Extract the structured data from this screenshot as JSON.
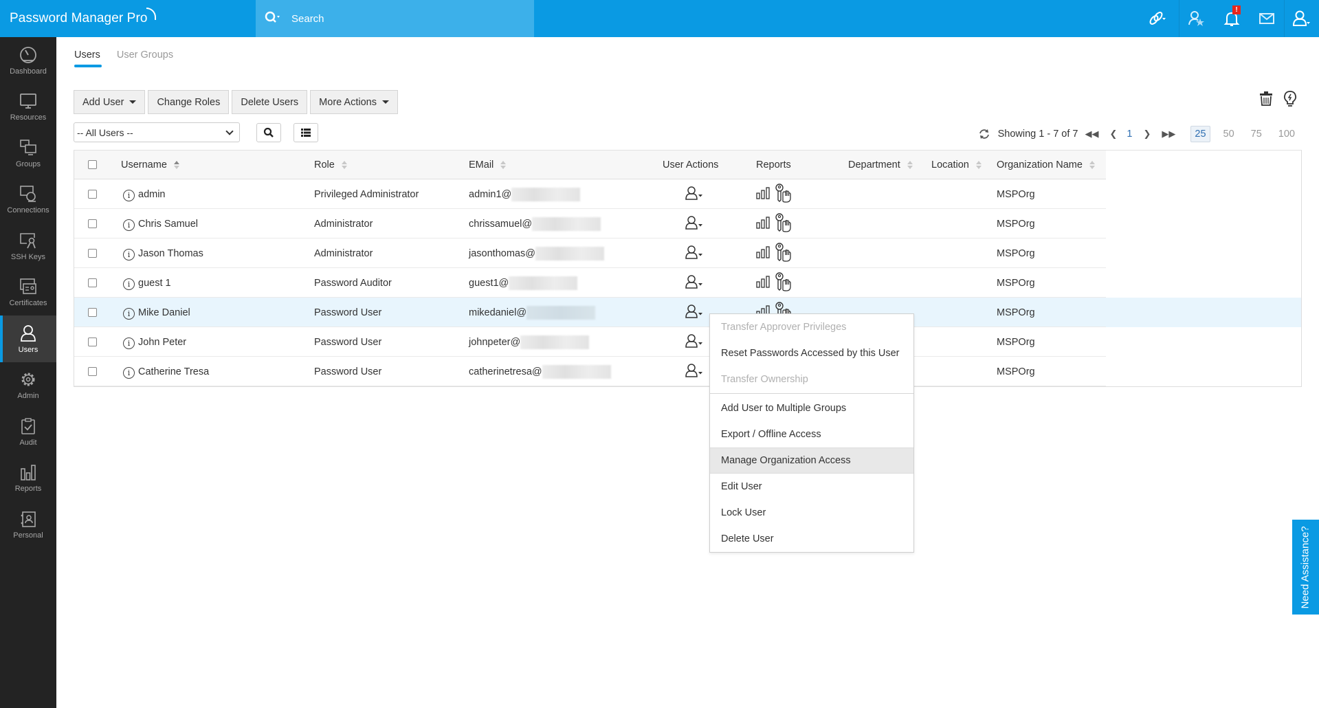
{
  "app": {
    "title": "Password Manager Pro",
    "search_placeholder": "Search",
    "notification_badge": "!"
  },
  "topbar_icons": [
    "link-icon",
    "user-star-icon",
    "bell-icon",
    "mail-icon",
    "user-profile-icon"
  ],
  "sidebar": {
    "items": [
      {
        "label": "Dashboard",
        "icon": "dashboard-icon",
        "active": false
      },
      {
        "label": "Resources",
        "icon": "monitor-icon",
        "active": false
      },
      {
        "label": "Groups",
        "icon": "groups-icon",
        "active": false
      },
      {
        "label": "Connections",
        "icon": "connections-icon",
        "active": false
      },
      {
        "label": "SSH Keys",
        "icon": "ssh-key-icon",
        "active": false
      },
      {
        "label": "Certificates",
        "icon": "certificate-icon",
        "active": false
      },
      {
        "label": "Users",
        "icon": "user-icon",
        "active": true
      },
      {
        "label": "Admin",
        "icon": "gear-icon",
        "active": false
      },
      {
        "label": "Audit",
        "icon": "clipboard-check-icon",
        "active": false
      },
      {
        "label": "Reports",
        "icon": "bar-chart-icon",
        "active": false
      },
      {
        "label": "Personal",
        "icon": "contact-book-icon",
        "active": false
      }
    ]
  },
  "tabs": [
    {
      "label": "Users",
      "active": true
    },
    {
      "label": "User Groups",
      "active": false
    }
  ],
  "toolbar": {
    "add_user": "Add User",
    "change_roles": "Change Roles",
    "delete_users": "Delete Users",
    "more_actions": "More Actions"
  },
  "filter": {
    "selected": "-- All Users --"
  },
  "pagination": {
    "status": "Showing 1 - 7 of 7",
    "current_page": "1",
    "page_sizes": [
      "25",
      "50",
      "75",
      "100"
    ],
    "selected_page_size": "25"
  },
  "table": {
    "columns": [
      "Username",
      "Role",
      "EMail",
      "User Actions",
      "Reports",
      "Department",
      "Location",
      "Organization Name"
    ],
    "rows": [
      {
        "username": "admin",
        "role": "Privileged Administrator",
        "email": "admin1@",
        "department": "",
        "location": "",
        "organization": "MSPOrg",
        "highlighted": false
      },
      {
        "username": "Chris Samuel",
        "role": "Administrator",
        "email": "chrissamuel@",
        "department": "",
        "location": "",
        "organization": "MSPOrg",
        "highlighted": false
      },
      {
        "username": "Jason Thomas",
        "role": "Administrator",
        "email": "jasonthomas@",
        "department": "",
        "location": "",
        "organization": "MSPOrg",
        "highlighted": false
      },
      {
        "username": "guest 1",
        "role": "Password Auditor",
        "email": "guest1@",
        "department": "",
        "location": "",
        "organization": "MSPOrg",
        "highlighted": false
      },
      {
        "username": "Mike Daniel",
        "role": "Password User",
        "email": "mikedaniel@",
        "department": "",
        "location": "",
        "organization": "MSPOrg",
        "highlighted": true
      },
      {
        "username": "John Peter",
        "role": "Password User",
        "email": "johnpeter@",
        "department": "",
        "location": "",
        "organization": "MSPOrg",
        "highlighted": false
      },
      {
        "username": "Catherine Tresa",
        "role": "Password User",
        "email": "catherinetresa@",
        "department": "",
        "location": "",
        "organization": "MSPOrg",
        "highlighted": false
      }
    ]
  },
  "user_actions_menu": {
    "items": [
      {
        "label": "Transfer Approver Privileges",
        "disabled": true
      },
      {
        "label": "Reset Passwords Accessed by this User",
        "disabled": false
      },
      {
        "label": "Transfer Ownership",
        "disabled": true
      },
      {
        "separator": true
      },
      {
        "label": "Add User to Multiple Groups",
        "disabled": false
      },
      {
        "label": "Export / Offline Access",
        "disabled": false
      },
      {
        "label": "Manage Organization Access",
        "disabled": false,
        "hovered": true
      },
      {
        "label": "Edit User",
        "disabled": false
      },
      {
        "label": "Lock User",
        "disabled": false
      },
      {
        "label": "Delete User",
        "disabled": false
      }
    ]
  },
  "assistance": {
    "label": "Need Assistance?"
  },
  "colors": {
    "brand": "#0a9ae3",
    "sidebar_bg": "#232323",
    "highlight_row": "#e8f5fd"
  }
}
